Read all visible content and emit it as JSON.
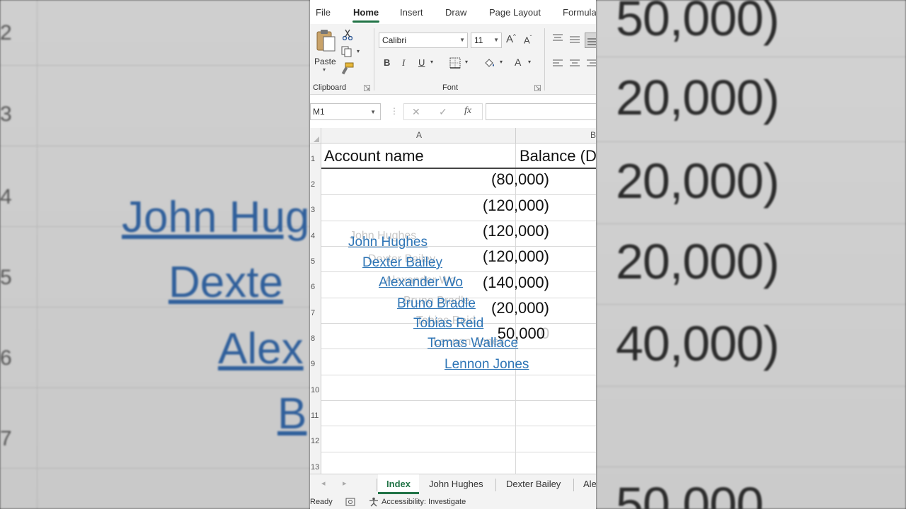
{
  "menu": {
    "file": "File",
    "home": "Home",
    "insert": "Insert",
    "draw": "Draw",
    "page_layout": "Page Layout",
    "formulas": "Formula"
  },
  "ribbon": {
    "paste_label": "Paste",
    "clipboard_label": "Clipboard",
    "font_label": "Font",
    "font_name": "Calibri",
    "font_size": "11",
    "bold": "B",
    "italic": "I",
    "underline": "U",
    "grow_font": "A",
    "shrink_font": "A",
    "font_color": "A"
  },
  "formula_bar": {
    "name_box": "M1",
    "fx": "fx"
  },
  "columns": [
    "A",
    "B"
  ],
  "rows": [
    "1",
    "2",
    "3",
    "4",
    "5",
    "6",
    "7",
    "8",
    "9",
    "10",
    "11",
    "12",
    "13"
  ],
  "sheet": {
    "header_a": "Account name",
    "header_b": "Balance (D",
    "balances": [
      "(80,000)",
      "(120,000)",
      "(120,000)",
      "(120,000)",
      "(140,000)",
      "(20,000)",
      "50,000"
    ],
    "links": [
      "John Hughes",
      "Dexter Bailey",
      "Alexander Wo",
      "Bruno Bradle",
      "Tobias Reid",
      "Tomas Wallace",
      "Lennon Jones"
    ]
  },
  "tabs": [
    "Index",
    "John Hughes",
    "Dexter Bailey",
    "Ale"
  ],
  "status": {
    "ready": "Ready",
    "accessibility": "Accessibility: Investigate"
  },
  "background": {
    "row_numbers": [
      "2",
      "3",
      "4",
      "5",
      "6",
      "7"
    ],
    "left_links": [
      "John Hug",
      "Dexte",
      "Alex",
      "B"
    ],
    "right_numbers": [
      "50,000)",
      "20,000)",
      "20,000)",
      "20,000)",
      "40,000)",
      "50,000"
    ]
  },
  "colors": {
    "accent": "#217346",
    "link": "#2e75b6"
  }
}
